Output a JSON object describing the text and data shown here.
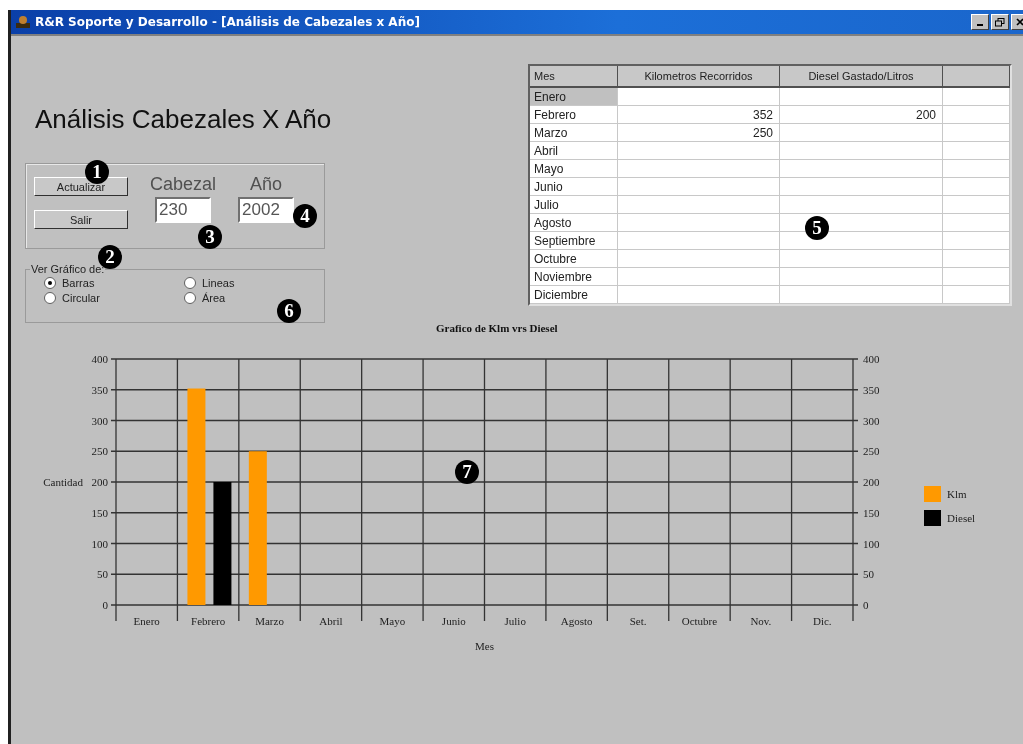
{
  "window": {
    "title": "R&R Soporte y Desarrollo - [Análisis de Cabezales x Año]"
  },
  "heading": "Análisis Cabezales X  Año",
  "actions": [
    {
      "label": "Actualizar",
      "callout": "1"
    },
    {
      "label": "Salir",
      "callout": "2"
    }
  ],
  "fields": [
    {
      "label": "Cabezal",
      "value": "230",
      "callout": "3"
    },
    {
      "label": "Año",
      "value": "2002",
      "callout": "4"
    }
  ],
  "chart_type_group": {
    "legend": "Ver Gráfico de:",
    "callout": "6",
    "options": [
      {
        "label": "Barras",
        "selected": true
      },
      {
        "label": "Lineas",
        "selected": false
      },
      {
        "label": "Circular",
        "selected": false
      },
      {
        "label": "Área",
        "selected": false
      }
    ]
  },
  "table": {
    "callout": "5",
    "columns": [
      "Mes",
      "Kilometros Recorridos",
      "Diesel Gastado/Litros"
    ],
    "rows": [
      {
        "mes": "Enero",
        "selected": true
      },
      {
        "mes": "Febrero",
        "km": "352",
        "diesel": "200",
        "selected": false
      },
      {
        "mes": "Marzo",
        "km": "250",
        "selected": false
      },
      {
        "mes": "Abril",
        "selected": false
      },
      {
        "mes": "Mayo",
        "selected": false
      },
      {
        "mes": "Junio",
        "selected": false
      },
      {
        "mes": "Julio",
        "selected": false
      },
      {
        "mes": "Agosto",
        "selected": false
      },
      {
        "mes": "Septiembre",
        "selected": false
      },
      {
        "mes": "Octubre",
        "selected": false
      },
      {
        "mes": "Noviembre",
        "selected": false
      },
      {
        "mes": "Diciembre",
        "selected": false
      }
    ]
  },
  "chart": {
    "callout": "7",
    "chart_data": {
      "type": "bar",
      "title": "Grafico de Klm vrs Diesel",
      "xlabel": "Mes",
      "ylabel": "Cantidad",
      "categories": [
        "Enero",
        "Febrero",
        "Marzo",
        "Abril",
        "Mayo",
        "Junio",
        "Julio",
        "Agosto",
        "Set.",
        "Octubre",
        "Nov.",
        "Dic."
      ],
      "series": [
        {
          "name": "Klm",
          "color": "#ff9900",
          "values": [
            null,
            352,
            250,
            null,
            null,
            null,
            null,
            null,
            null,
            null,
            null,
            null
          ]
        },
        {
          "name": "Diesel",
          "color": "#000000",
          "values": [
            null,
            200,
            null,
            null,
            null,
            null,
            null,
            null,
            null,
            null,
            null,
            null
          ]
        }
      ],
      "ylim": [
        0,
        400
      ],
      "yticks": [
        0,
        50,
        100,
        150,
        200,
        250,
        300,
        350,
        400
      ],
      "y2ticks": [
        0,
        50,
        100,
        150,
        200,
        250,
        300,
        350,
        400
      ],
      "y2lim": [
        0,
        400
      ],
      "grid": true,
      "legend": true
    }
  }
}
